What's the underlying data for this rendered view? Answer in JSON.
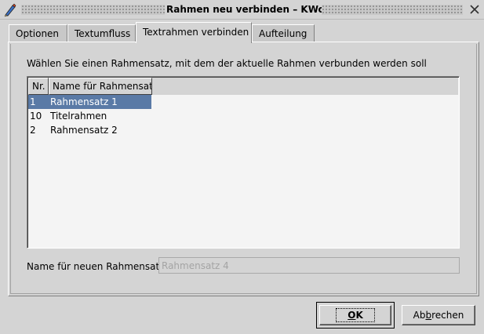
{
  "window": {
    "title": "Rahmen neu verbinden – KWord",
    "app_icon": "kword-pen-icon",
    "close_icon": "close-icon"
  },
  "tabs": [
    {
      "label": "Optionen",
      "active": false
    },
    {
      "label": "Textumfluss",
      "active": false
    },
    {
      "label": "Textrahmen verbinden",
      "active": true
    },
    {
      "label": "Aufteilung",
      "active": false
    }
  ],
  "content": {
    "prompt": "Wählen Sie einen Rahmensatz, mit dem der aktuelle Rahmen verbunden werden soll",
    "columns": {
      "nr": "Nr.",
      "name": "Name für Rahmensatz"
    },
    "rows": [
      {
        "nr": "1",
        "name": "Rahmensatz 1",
        "selected": true
      },
      {
        "nr": "10",
        "name": "Titelrahmen",
        "selected": false
      },
      {
        "nr": "2",
        "name": "Rahmensatz 2",
        "selected": false
      }
    ],
    "new_set_label": "Name für neuen Rahmensatz:",
    "new_set_value": "Rahmensatz 4"
  },
  "buttons": {
    "ok_prefix": "",
    "ok_mnemonic": "O",
    "ok_rest": "K",
    "cancel_prefix": "Ab",
    "cancel_mnemonic": "b",
    "cancel_rest": "rechen"
  },
  "colors": {
    "selection": "#5a7aa6",
    "background": "#d4d4d4"
  }
}
